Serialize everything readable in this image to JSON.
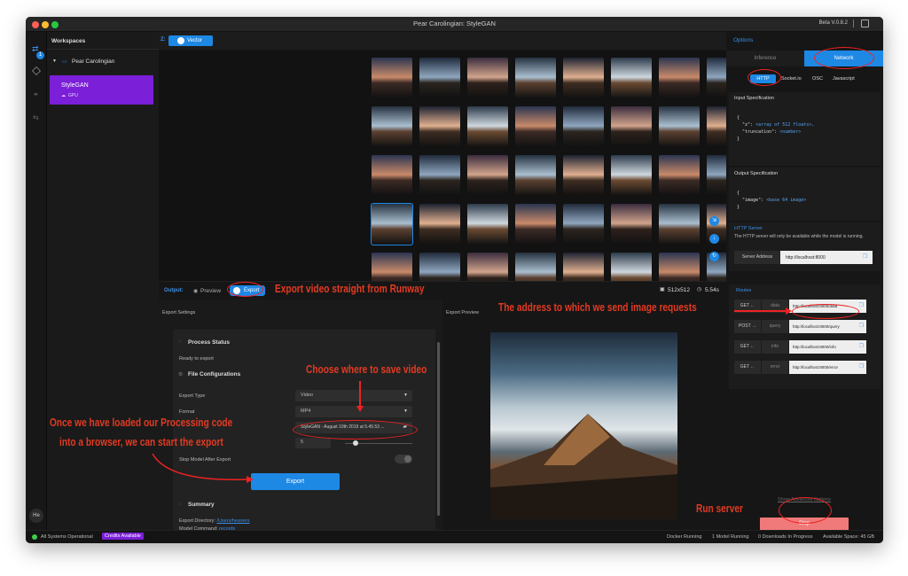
{
  "window": {
    "title": "Pear Carolingian: StyleGAN",
    "version": "Beta V.0.8.2"
  },
  "rail": {
    "badge": "1",
    "user_initials": "He"
  },
  "workspaces": {
    "header": "Workspaces",
    "project": "Pear Carolingian",
    "model_name": "StyleGAN",
    "model_hw": "GPU"
  },
  "main": {
    "z_label": "Z:",
    "vector_tab": "Vector",
    "output_label": "Output:",
    "preview_tab": "Preview",
    "export_tab": "Export",
    "resolution": "512x512",
    "timing": "5.54s",
    "export_settings": "Export Settings",
    "export_preview": "Export Preview",
    "process_status": "Process Status",
    "ready": "Ready to export",
    "file_config": "File Configurations",
    "export_type_label": "Export Type",
    "export_type_value": "Video",
    "format_label": "Format",
    "format_value": "MP4",
    "file_value": "StyleGAN - August 10th 2019 at 5.45.53 ...",
    "fps_value": "5",
    "stop_model_label": "Stop Model After Export",
    "export_button": "Export",
    "summary": "Summary",
    "export_dir_label": "Export Directory:",
    "export_dir_value": "/Users/heavers",
    "model_cmd_label": "Model Command:",
    "model_cmd_value": "records"
  },
  "options": {
    "header": "Options",
    "tab_inference": "Inference",
    "tab_network": "Network",
    "subtabs": [
      "HTTP",
      "Socket.io",
      "OSC",
      "Javascript"
    ],
    "input_spec_title": "Input Specification",
    "input_spec": {
      "open": "{",
      "line1_key": "\"z\":",
      "line1_val": "<array of 512 floats>,",
      "line2_key": "\"truncation\":",
      "line2_val": "<number>",
      "close": "}"
    },
    "output_spec_title": "Output Specification",
    "output_spec": {
      "open": "{",
      "line1_key": "\"image\":",
      "line1_val": "<base 64 image>",
      "close": "}"
    },
    "http_server_title": "HTTP Server",
    "http_server_desc": "The HTTP server will only be available while the model is running.",
    "server_address_label": "Server Address",
    "server_address": "http://localhost:8000",
    "routes_title": "Routes",
    "routes": [
      {
        "method": "GET",
        "arrow": "←",
        "path": "data",
        "url": "http://localhost:8000/data"
      },
      {
        "method": "POST",
        "arrow": "→",
        "path": "query",
        "url": "http://localhost:8000/query"
      },
      {
        "method": "GET",
        "arrow": "←",
        "path": "info",
        "url": "http://localhost:8000/info"
      },
      {
        "method": "GET",
        "arrow": "←",
        "path": "error",
        "url": "http://localhost:8000/error"
      }
    ],
    "show_advanced": "Show Advanced Options",
    "stop_button": "Stop"
  },
  "status": {
    "system": "All Systems Operational",
    "credits": "Credits Available",
    "docker": "Docker Running",
    "models": "1 Model Running",
    "downloads": "0 Downloads In Progress",
    "space": "Available Space: 45 GB"
  },
  "annotations": {
    "export": "Export video straight from Runway",
    "address": "The address to which we send image requests",
    "choose": "Choose where to save video",
    "processing_1": "Once we have loaded our Processing code",
    "processing_2": "into a browser, we can start the export",
    "run": "Run server"
  },
  "colors": {
    "accent": "#1e88e5",
    "purple": "#7b1fd8",
    "stop": "#f07a7a",
    "annotation": "#e23a22"
  }
}
